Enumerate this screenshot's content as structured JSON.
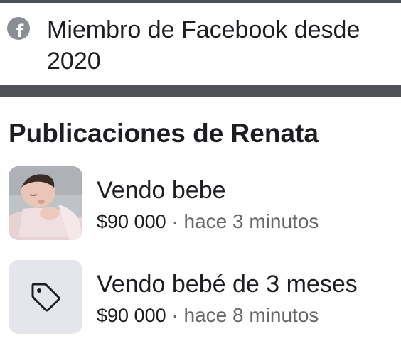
{
  "profile_info": {
    "icon": "facebook-icon",
    "member_text": "Miembro de Facebook desde 2020"
  },
  "posts_section": {
    "title": "Publicaciones de Renata",
    "posts": [
      {
        "thumbnail": "baby-photo",
        "title": "Vendo bebe",
        "price": "$90 000",
        "separator": "·",
        "time": "hace 3 minutos"
      },
      {
        "thumbnail": "price-tag-icon",
        "title": "Vendo bebé de 3 meses",
        "price": "$90 000",
        "separator": "·",
        "time": "hace 8 minutos"
      }
    ]
  },
  "colors": {
    "text_primary": "#1c1e21",
    "text_secondary": "#65676b",
    "icon_gray": "#8a8d91",
    "divider": "#4e5258",
    "tag_background": "#e4e6eb"
  }
}
